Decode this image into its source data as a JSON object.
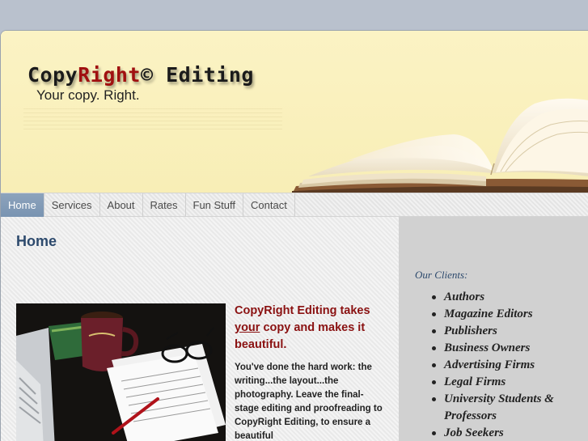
{
  "header": {
    "logo_part1": "Copy",
    "logo_part2": "Right",
    "logo_part3": "© Editing",
    "tagline": "Your copy. Right."
  },
  "nav": {
    "items": [
      {
        "label": "Home"
      },
      {
        "label": "Services"
      },
      {
        "label": "About"
      },
      {
        "label": "Rates"
      },
      {
        "label": "Fun Stuff"
      },
      {
        "label": "Contact"
      }
    ],
    "active": "Home"
  },
  "main": {
    "title": "Home",
    "intro_pre": "CopyRight Editing takes ",
    "intro_underlined": "your",
    "intro_post": " copy and makes it beautiful.",
    "body": "You've done the hard work: the writing...the layout...the photography.  Leave the final-stage editing and proofreading to CopyRight Editing, to ensure a beautiful"
  },
  "sidebar": {
    "clients_title": "Our Clients:",
    "clients": [
      "Authors",
      "Magazine Editors",
      "Publishers",
      "Business Owners",
      "Advertising Firms",
      "Legal Firms",
      "University Students & Professors",
      "Job Seekers"
    ]
  },
  "colors": {
    "accent": "#2d4a6d",
    "brand_red": "#a01010",
    "header_bg": "#fbf3c4",
    "nav_active": "#8da3bc"
  }
}
